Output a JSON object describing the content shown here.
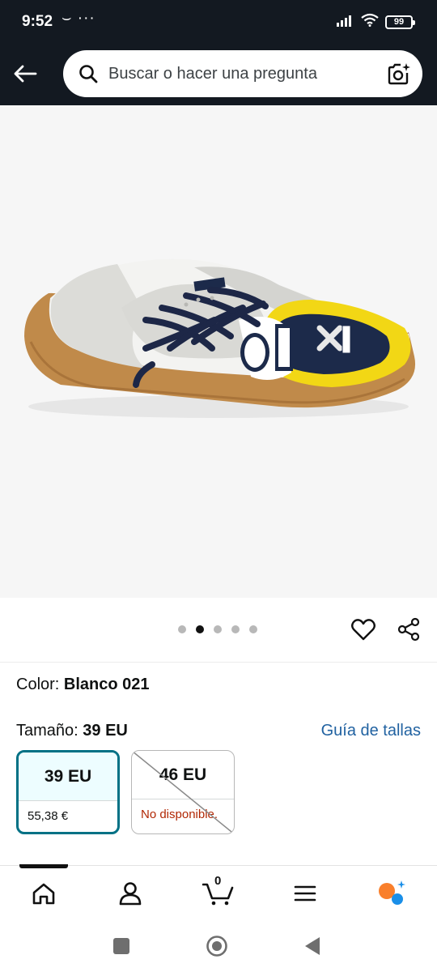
{
  "status_bar": {
    "time": "9:52",
    "extra": "⌣ ···",
    "battery": "99"
  },
  "header": {
    "back_label": "←",
    "search_placeholder": "Buscar o hacer una pregunta"
  },
  "product": {
    "image_alt": "Zapatilla Munich blanca con cordones azul marino y forro amarillo",
    "carousel": {
      "total": 5,
      "active_index": 1
    }
  },
  "variation": {
    "color_label": "Color:",
    "color_value": "Blanco 021",
    "size_label": "Tamaño:",
    "size_value": "39 EU",
    "size_guide_label": "Guía de tallas",
    "options": [
      {
        "size": "39 EU",
        "price": "55,38 €",
        "available": true
      },
      {
        "size": "46 EU",
        "price": "No disponible.",
        "available": false
      }
    ]
  },
  "bottom_nav": {
    "cart_count": "0",
    "items": [
      "home",
      "account",
      "cart",
      "menu",
      "rufus"
    ]
  },
  "colors": {
    "header_bg": "#131921",
    "accent_teal": "#007185",
    "link_blue": "#2162a1",
    "unavailable_red": "#b12704"
  }
}
